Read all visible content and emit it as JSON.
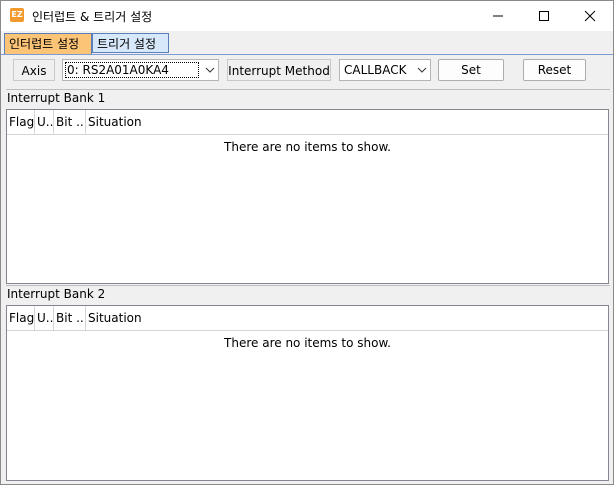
{
  "window": {
    "icon_text": "EZ",
    "title": "인터럽트 & 트리거 설정"
  },
  "tabs": [
    {
      "label": "인터럽트 설정",
      "active": true
    },
    {
      "label": "트리거 설정",
      "active": false
    }
  ],
  "toolbar": {
    "axis_label": "Axis",
    "axis_value": "0: RS2A01A0KA4",
    "method_label": "Interrupt Method",
    "method_value": "CALLBACK",
    "set_label": "Set",
    "reset_label": "Reset"
  },
  "banks": [
    {
      "title": "Interrupt Bank 1",
      "columns": [
        "Flag",
        "U...",
        "Bit ...",
        "Situation"
      ],
      "empty_text": "There are no items to show."
    },
    {
      "title": "Interrupt Bank 2",
      "columns": [
        "Flag",
        "U...",
        "Bit ...",
        "Situation"
      ],
      "empty_text": "There are no items to show."
    }
  ],
  "colors": {
    "active_tab": "#fbc477",
    "inactive_tab": "#d7e8fb",
    "tab_border": "#5b7fb8",
    "app_icon": "#f29a2e"
  }
}
